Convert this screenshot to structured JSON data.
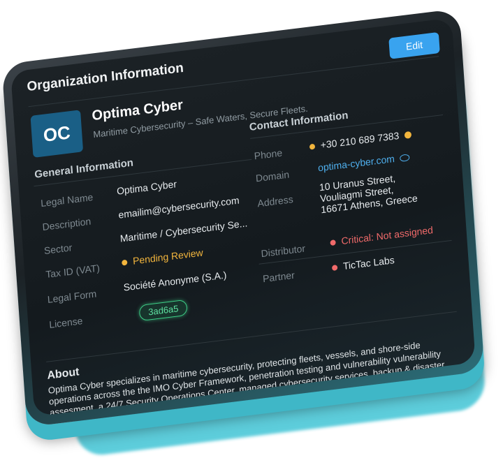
{
  "page_title": "Organization Information",
  "edit_label": "Edit",
  "org": {
    "initials": "OC",
    "name": "Optima Cyber",
    "tagline": "Maritime Cybersecurity – Safe Waters, Secure Fleets."
  },
  "general": {
    "heading": "General Information",
    "labels": {
      "legal_name": "Legal Name",
      "description": "Description",
      "sector": "Sector",
      "tax_id": "Tax ID (VAT)",
      "legal_form": "Legal Form",
      "license": "License"
    },
    "values": {
      "legal_name": "Optima Cyber",
      "description": "emailim@cybersecurity.com",
      "sector": "Maritime / Cybersecurity Se...",
      "tax_id": "Pending Review",
      "legal_form": "Société Anonyme (S.A.)",
      "license": "3ad6a5"
    }
  },
  "contact": {
    "heading": "Contact Information",
    "labels": {
      "phone": "Phone",
      "domain": "Domain",
      "address": "Address",
      "distributor": "Distributor",
      "partner": "Partner"
    },
    "values": {
      "phone": "+30 210 689 7383",
      "domain": "optima-cyber.com",
      "address_line1": "10 Uranus Street,",
      "address_line2": "Vouliagmi Street,",
      "address_line3": "16671 Athens, Greece",
      "distributor": "Critical: Not assigned",
      "partner": "TicTac Labs"
    }
  },
  "about": {
    "heading": "About",
    "text": "Optima Cyber specializes in maritime cybersecurity, protecting fleets, vessels, and shore-side operations across the the IMO Cyber Framework, penetration testing and vulnerability vulnerability assesment, a 24/7 Security Operations Center, managed cybersecurity services, backup & disaster recovery."
  },
  "colors": {
    "accent": "#39a3ef",
    "warning": "#f2b53d",
    "critical": "#f06a6a",
    "success": "#3ecf87"
  }
}
